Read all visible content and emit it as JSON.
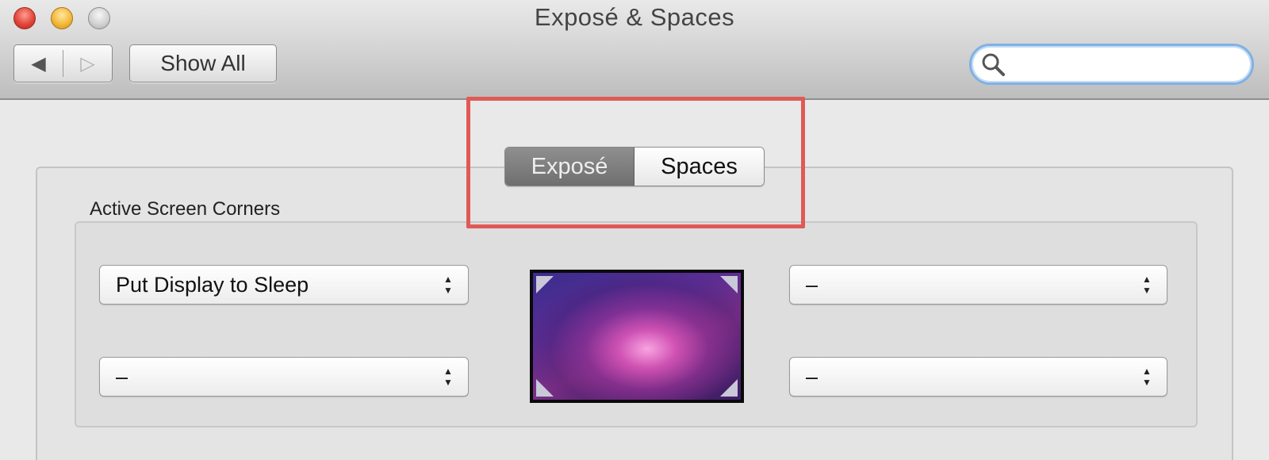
{
  "window": {
    "title": "Exposé & Spaces"
  },
  "toolbar": {
    "back_icon": "back-arrow-icon",
    "forward_icon": "forward-arrow-icon",
    "back_glyph": "◀",
    "forward_glyph": "▷",
    "show_all_label": "Show All",
    "search": {
      "value": "",
      "placeholder": "",
      "icon": "magnifier-icon"
    }
  },
  "tabs": [
    {
      "label": "Exposé",
      "selected": true
    },
    {
      "label": "Spaces",
      "selected": false
    }
  ],
  "active_screen_corners": {
    "label": "Active Screen Corners",
    "top_left": "Put Display to Sleep",
    "top_right": "–",
    "bottom_left": "–",
    "bottom_right": "–"
  },
  "colors": {
    "highlight_box": "#e05a55",
    "search_focus_ring": "#7fb1e4"
  }
}
